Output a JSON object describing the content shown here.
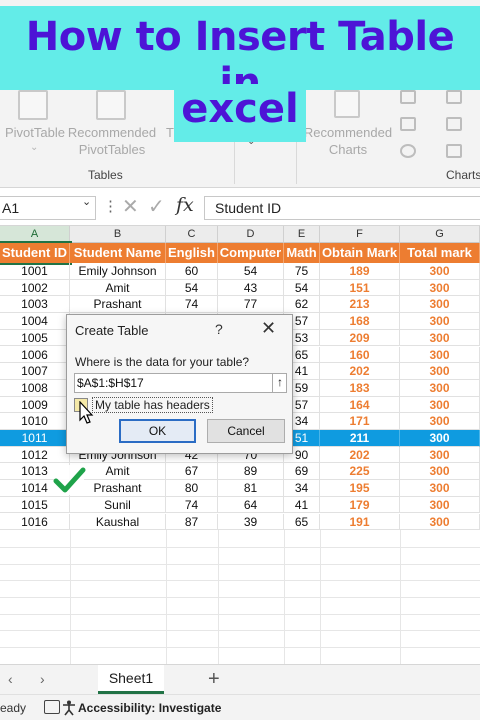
{
  "overlay": {
    "line1": "How to Insert Table in",
    "line2": "excel"
  },
  "ribbon": {
    "pivottable": "PivotTable",
    "recommended_pivot": "Recommended\nPivotTables",
    "table_partial": "T",
    "recommended_charts": "Recommended\nCharts",
    "group_tables": "Tables",
    "group_charts": "Charts"
  },
  "formula_bar": {
    "name_box": "A1",
    "fx": "fx",
    "formula": "Student ID"
  },
  "grid": {
    "columns": [
      "A",
      "B",
      "C",
      "D",
      "E",
      "F",
      "G"
    ],
    "headers": [
      "Student ID",
      "Student Name",
      "English",
      "Computer",
      "Math",
      "Obtain Mark",
      "Total mark"
    ],
    "rows": [
      [
        "1001",
        "Emily Johnson",
        "60",
        "54",
        "75",
        "189",
        "300"
      ],
      [
        "1002",
        "Amit",
        "54",
        "43",
        "54",
        "151",
        "300"
      ],
      [
        "1003",
        "Prashant",
        "74",
        "77",
        "62",
        "213",
        "300"
      ],
      [
        "1004",
        "",
        "",
        "",
        "57",
        "168",
        "300"
      ],
      [
        "1005",
        "",
        "",
        "",
        "53",
        "209",
        "300"
      ],
      [
        "1006",
        "",
        "",
        "",
        "65",
        "160",
        "300"
      ],
      [
        "1007",
        "",
        "",
        "",
        "41",
        "202",
        "300"
      ],
      [
        "1008",
        "",
        "",
        "",
        "59",
        "183",
        "300"
      ],
      [
        "1009",
        "",
        "",
        "",
        "57",
        "164",
        "300"
      ],
      [
        "1010",
        "",
        "",
        "",
        "34",
        "171",
        "300"
      ],
      [
        "1011",
        "",
        "",
        "",
        "51",
        "211",
        "300"
      ],
      [
        "1012",
        "Emily Johnson",
        "42",
        "70",
        "90",
        "202",
        "300"
      ],
      [
        "1013",
        "Amit",
        "67",
        "89",
        "69",
        "225",
        "300"
      ],
      [
        "1014",
        "Prashant",
        "80",
        "81",
        "34",
        "195",
        "300"
      ],
      [
        "1015",
        "Sunil",
        "74",
        "64",
        "41",
        "179",
        "300"
      ],
      [
        "1016",
        "Kaushal",
        "87",
        "39",
        "65",
        "191",
        "300"
      ]
    ],
    "highlighted_row": 10
  },
  "dialog": {
    "title": "Create Table",
    "help": "?",
    "close": "✕",
    "question": "Where is the data for your table?",
    "range": "$A$1:$H$17",
    "checkbox_label": "My table has headers",
    "checkbox_checked": false,
    "ok": "OK",
    "cancel": "Cancel"
  },
  "tabs": {
    "sheet": "Sheet1",
    "prev": "‹",
    "next": "›",
    "add": "+"
  },
  "status": {
    "ready": "eady",
    "accessibility": "Accessibility: Investigate"
  },
  "colors": {
    "header": "#ed7d31",
    "selection": "#0f9be0",
    "title_bg": "#63ece8",
    "title_text": "#4d14d6",
    "excel_green": "#217346"
  }
}
